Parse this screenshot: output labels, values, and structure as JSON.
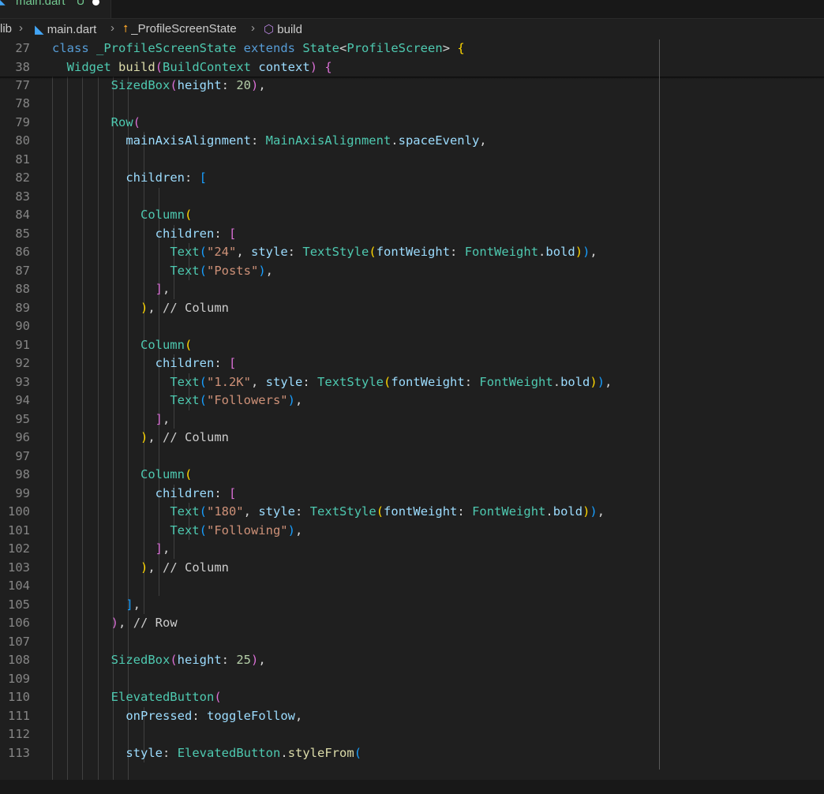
{
  "tab": {
    "filename": "main.dart",
    "status": "U",
    "icon": "dart-file-icon",
    "label_color": "#73c991"
  },
  "breadcrumb": {
    "items": [
      {
        "label": "lib",
        "icon": ""
      },
      {
        "label": "main.dart",
        "icon": "dart-file-icon"
      },
      {
        "label": "_ProfileScreenState",
        "icon": "class-icon"
      },
      {
        "label": "build",
        "icon": "method-icon"
      }
    ],
    "separator_icon": "chevron-right-icon"
  },
  "editor": {
    "theme": {
      "background": "#1f1f1f",
      "line_number_color": "#858585",
      "keyword": "#569cd6",
      "type": "#4ec9b0",
      "function": "#dcdcaa",
      "property": "#9cdcfe",
      "string": "#ce9178",
      "number": "#b5cea8"
    },
    "sticky_lines": [
      {
        "n": "27",
        "text": "class _ProfileScreenState extends State<ProfileScreen> {"
      },
      {
        "n": "38",
        "text": "  Widget build(BuildContext context) {"
      }
    ],
    "lines": [
      {
        "n": "77",
        "text": "        SizedBox(height: 20),"
      },
      {
        "n": "78",
        "text": ""
      },
      {
        "n": "79",
        "text": "        Row("
      },
      {
        "n": "80",
        "text": "          mainAxisAlignment: MainAxisAlignment.spaceEvenly,"
      },
      {
        "n": "81",
        "text": ""
      },
      {
        "n": "82",
        "text": "          children: ["
      },
      {
        "n": "83",
        "text": ""
      },
      {
        "n": "84",
        "text": "            Column("
      },
      {
        "n": "85",
        "text": "              children: ["
      },
      {
        "n": "86",
        "text": "                Text(\"24\", style: TextStyle(fontWeight: FontWeight.bold)),"
      },
      {
        "n": "87",
        "text": "                Text(\"Posts\"),"
      },
      {
        "n": "88",
        "text": "              ],"
      },
      {
        "n": "89",
        "text": "            ), // Column"
      },
      {
        "n": "90",
        "text": ""
      },
      {
        "n": "91",
        "text": "            Column("
      },
      {
        "n": "92",
        "text": "              children: ["
      },
      {
        "n": "93",
        "text": "                Text(\"1.2K\", style: TextStyle(fontWeight: FontWeight.bold)),"
      },
      {
        "n": "94",
        "text": "                Text(\"Followers\"),"
      },
      {
        "n": "95",
        "text": "              ],"
      },
      {
        "n": "96",
        "text": "            ), // Column"
      },
      {
        "n": "97",
        "text": ""
      },
      {
        "n": "98",
        "text": "            Column("
      },
      {
        "n": "99",
        "text": "              children: ["
      },
      {
        "n": "100",
        "text": "                Text(\"180\", style: TextStyle(fontWeight: FontWeight.bold)),"
      },
      {
        "n": "101",
        "text": "                Text(\"Following\"),"
      },
      {
        "n": "102",
        "text": "              ],"
      },
      {
        "n": "103",
        "text": "            ), // Column"
      },
      {
        "n": "104",
        "text": ""
      },
      {
        "n": "105",
        "text": "          ],"
      },
      {
        "n": "106",
        "text": "        ), // Row"
      },
      {
        "n": "107",
        "text": ""
      },
      {
        "n": "108",
        "text": "        SizedBox(height: 25),"
      },
      {
        "n": "109",
        "text": ""
      },
      {
        "n": "110",
        "text": "        ElevatedButton("
      },
      {
        "n": "111",
        "text": "          onPressed: toggleFollow,"
      },
      {
        "n": "112",
        "text": ""
      },
      {
        "n": "113",
        "text": "          style: ElevatedButton.styleFrom("
      }
    ]
  }
}
